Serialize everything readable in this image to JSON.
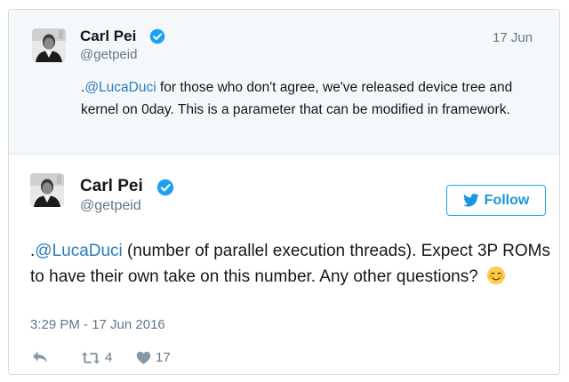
{
  "parent_tweet": {
    "name": "Carl Pei",
    "handle": "@getpeid",
    "date": "17 Jun",
    "text_prefix": ".",
    "mention": "@LucaDuci",
    "text_body": " for those who don't agree, we've released device tree and kernel on 0day. This is a parameter that can be modified in framework."
  },
  "main_tweet": {
    "name": "Carl Pei",
    "handle": "@getpeid",
    "follow_label": "Follow",
    "text_prefix": ".",
    "mention": "@LucaDuci",
    "text_body": " (number of parallel execution threads). Expect 3P ROMs to have their own take on this number. Any other questions? ",
    "emoji": "smiling-face-with-blush",
    "timestamp": "3:29 PM - 17 Jun 2016",
    "retweets": "4",
    "likes": "17"
  },
  "colors": {
    "accent": "#1da1f2",
    "link": "#2b7bb9",
    "muted": "#657786",
    "parent_bg": "#f5f8fa",
    "border": "#d6dbdf"
  },
  "icons": {
    "verified": "verified-badge-icon",
    "follow": "bird-icon",
    "reply": "reply-icon",
    "retweet": "retweet-icon",
    "like": "heart-icon"
  }
}
